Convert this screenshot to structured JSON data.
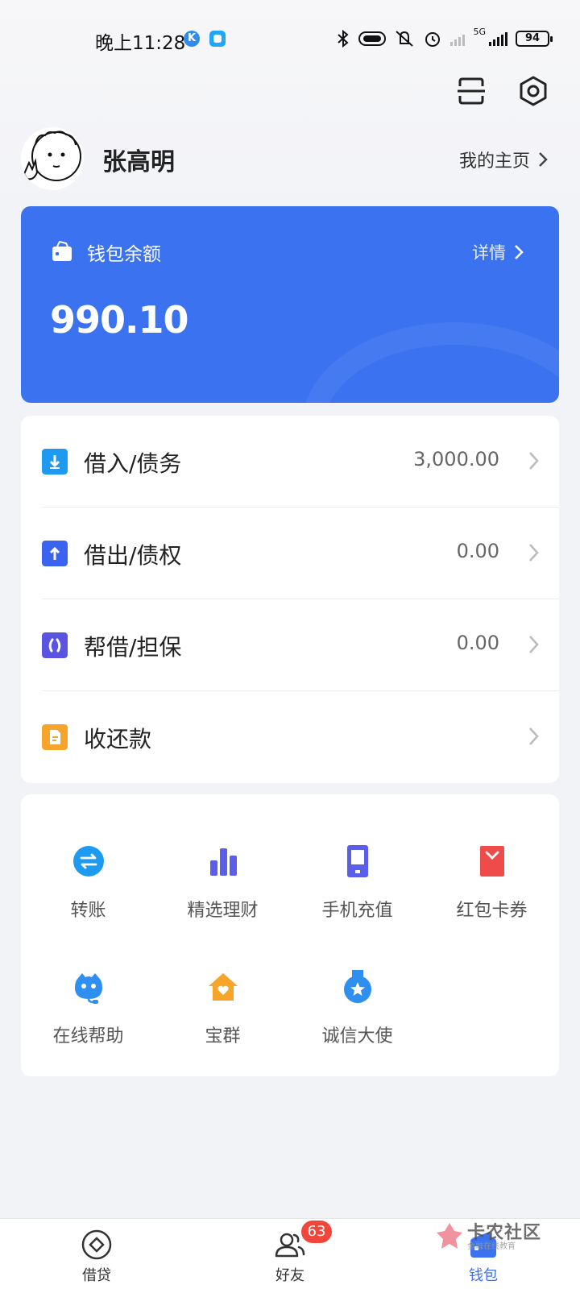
{
  "status_bar": {
    "time": "晚上11:28",
    "network": "5G",
    "battery": "94"
  },
  "profile": {
    "name": "张高明",
    "homepage_link": "我的主页"
  },
  "wallet": {
    "label": "钱包余额",
    "detail_label": "详情",
    "balance": "990.10"
  },
  "list": [
    {
      "label": "借入/债务",
      "value": "3,000.00",
      "icon": "arrow-down-icon",
      "color": "#1e9bf0"
    },
    {
      "label": "借出/债权",
      "value": "0.00",
      "icon": "arrow-up-icon",
      "color": "#3a63f0"
    },
    {
      "label": "帮借/担保",
      "value": "0.00",
      "icon": "guarantee-icon",
      "color": "#5b54e0"
    },
    {
      "label": "收还款",
      "value": "",
      "icon": "document-icon",
      "color": "#f7a52a"
    }
  ],
  "services": [
    {
      "label": "转账",
      "icon": "transfer-icon",
      "color": "#1e9bf0"
    },
    {
      "label": "精选理财",
      "icon": "bar-chart-icon",
      "color": "#5b5ee8"
    },
    {
      "label": "手机充值",
      "icon": "phone-icon",
      "color": "#5b5ee8"
    },
    {
      "label": "红包卡券",
      "icon": "red-envelope-icon",
      "color": "#f04b4b"
    },
    {
      "label": "在线帮助",
      "icon": "support-robot-icon",
      "color": "#2e8ff0"
    },
    {
      "label": "宝群",
      "icon": "house-heart-icon",
      "color": "#f7a52a"
    },
    {
      "label": "诚信大使",
      "icon": "medal-icon",
      "color": "#2e8ff0"
    }
  ],
  "nav": {
    "loan": "借贷",
    "friends": "好友",
    "friends_badge": "63",
    "wallet": "钱包"
  },
  "watermark": {
    "main": "卡农社区",
    "sub": "金融在线教育"
  },
  "colors": {
    "accent": "#3a72f0",
    "background": "#f2f3f7",
    "badge": "#f0463c"
  }
}
